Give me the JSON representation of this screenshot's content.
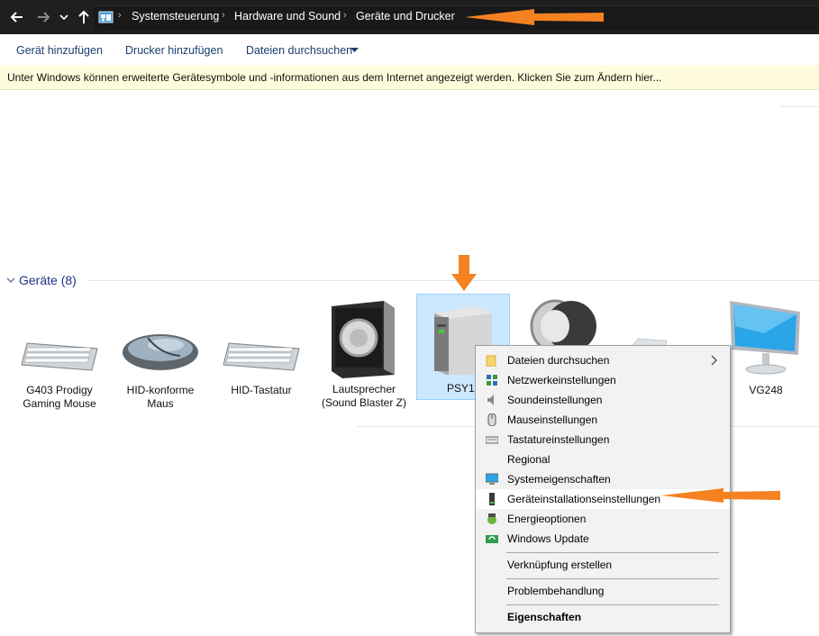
{
  "breadcrumbs": [
    "Systemsteuerung",
    "Hardware und Sound",
    "Geräte und Drucker"
  ],
  "toolbar": {
    "add_device": "Gerät hinzufügen",
    "add_printer": "Drucker hinzufügen",
    "browse_files": "Dateien durchsuchen"
  },
  "infobar": {
    "text": "Unter Windows können erweiterte Gerätesymbole und -informationen aus dem Internet angezeigt werden. Klicken Sie zum Ändern hier..."
  },
  "group": {
    "label": "Geräte (8)"
  },
  "devices": [
    {
      "line1": "G403 Prodigy",
      "line2": "Gaming Mouse"
    },
    {
      "line1": "HID-konforme",
      "line2": "Maus"
    },
    {
      "line1": "HID-Tastatur",
      "line2": ""
    },
    {
      "line1": "Lautsprecher",
      "line2": "(Sound Blaster Z)"
    },
    {
      "line1": "PSY18",
      "line2": ""
    },
    {
      "line1": "VG248",
      "line2": ""
    }
  ],
  "context_menu": {
    "items": [
      {
        "label": "Dateien durchsuchen",
        "icon": "folder-icon"
      },
      {
        "label": "Netzwerkeinstellungen",
        "icon": "network-icon"
      },
      {
        "label": "Soundeinstellungen",
        "icon": "speaker-icon"
      },
      {
        "label": "Mauseinstellungen",
        "icon": "mouse-icon"
      },
      {
        "label": "Tastatureinstellungen",
        "icon": "keyboard-icon"
      },
      {
        "label": "Regional",
        "icon": ""
      },
      {
        "label": "Systemeigenschaften",
        "icon": "monitor-icon"
      },
      {
        "label": "Geräteinstallationseinstellungen",
        "icon": "tower-icon"
      },
      {
        "label": "Energieoptionen",
        "icon": "power-options-icon"
      },
      {
        "label": "Windows Update",
        "icon": "windows-update-icon"
      },
      {
        "label": "Verknüpfung erstellen",
        "icon": ""
      },
      {
        "label": "Problembehandlung",
        "icon": ""
      },
      {
        "label": "Eigenschaften",
        "icon": ""
      }
    ]
  },
  "colors": {
    "accent_arrow": "#f58220",
    "selection": "#cce8ff",
    "group_label": "#1e3287"
  }
}
